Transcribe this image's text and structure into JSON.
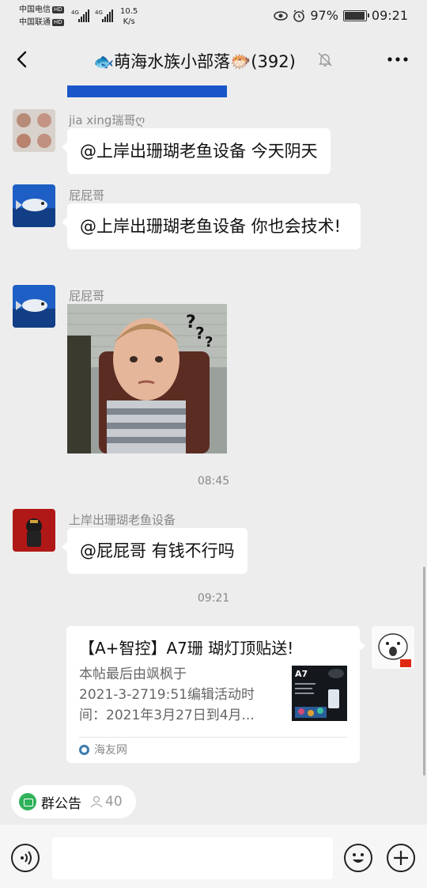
{
  "status": {
    "carrier1": "中国电信",
    "carrier2": "中国联通",
    "hd": "HD",
    "net1": "4G",
    "net2": "4G",
    "speed_value": "10.5",
    "speed_unit": "K/s",
    "battery": "97%",
    "time": "09:21",
    "battery_level": 0.97
  },
  "header": {
    "title": "🐟萌海水族小部落🐡(392)"
  },
  "messages": [
    {
      "sender": "jia xing瑞哥ღ",
      "text": "@上岸出珊瑚老鱼设备  今天阴天"
    },
    {
      "sender": "屁屁哥",
      "text": "@上岸出珊瑚老鱼设备  你也会技术!"
    },
    {
      "sender": "屁屁哥",
      "image": "photo-toddler-confused"
    },
    {
      "time": "08:45"
    },
    {
      "sender": "上岸出珊瑚老鱼设备",
      "text": "@屁屁哥  有钱不行吗"
    },
    {
      "time": "09:21"
    }
  ],
  "link_card": {
    "title": "【A+智控】A7珊 瑚灯顶贴送!",
    "desc_line1": "本帖最后由飒枫于",
    "desc_line2": "2021-3-2719:51编辑活动时",
    "desc_line3": "间：2021年3月27日到4月...",
    "thumb_label": "A7",
    "source": "海友网"
  },
  "notice": {
    "label": "群公告",
    "count": "40"
  },
  "icons": {
    "back": "back-arrow-icon",
    "mute": "mute-bell-icon",
    "more": "more-icon",
    "voice": "voice-icon",
    "emoji": "emoji-icon",
    "plus": "plus-icon"
  },
  "colors": {
    "background": "#ededed",
    "bubble": "#ffffff",
    "notice_icon": "#2fb25a"
  }
}
